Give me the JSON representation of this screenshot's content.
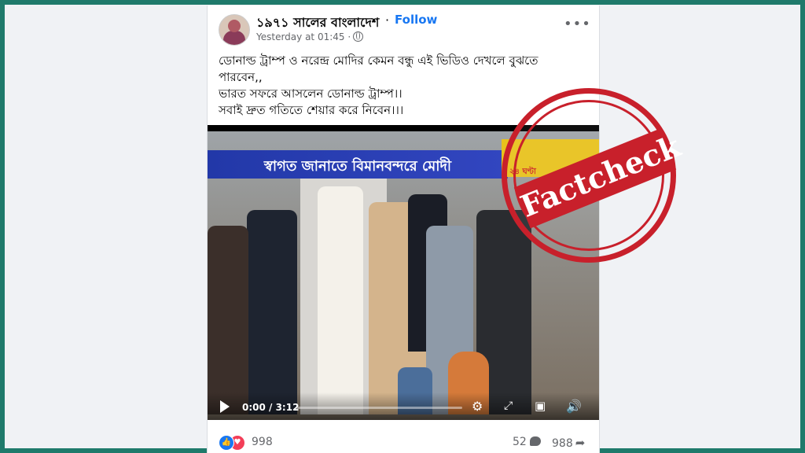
{
  "post": {
    "page_name": "১৯৭১ সালের বাংলাদেশ",
    "separator": "·",
    "follow_label": "Follow",
    "timestamp": "Yesterday at 01:45 ·",
    "more_label": "•••",
    "caption_lines": [
      "ডোনাল্ড ট্রাম্প ও নরেন্দ্র মোদির কেমন বন্ধু এই ভিডিও দেখলে বুঝতে",
      "পারবেন,,",
      "ভারত সফরে আসলেন ডোনাল্ড ট্রাম্প।।",
      "সবাই দ্রুত গতিতে শেয়ার করে নিবেন।।।"
    ]
  },
  "video": {
    "banner_text": "স্বাগত জানাতে বিমানবন্দরে মোদী",
    "channel_tag": "২৪ ঘণ্টা",
    "current_time": "0:00 / 3:12",
    "progress": 0
  },
  "stamp": {
    "text": "Factcheck",
    "color": "#c8202b"
  },
  "stats": {
    "reaction_count": "998",
    "comment_count": "52",
    "share_count": "988"
  },
  "colors": {
    "background": "#1f7a6b",
    "accent": "#1877f2"
  }
}
